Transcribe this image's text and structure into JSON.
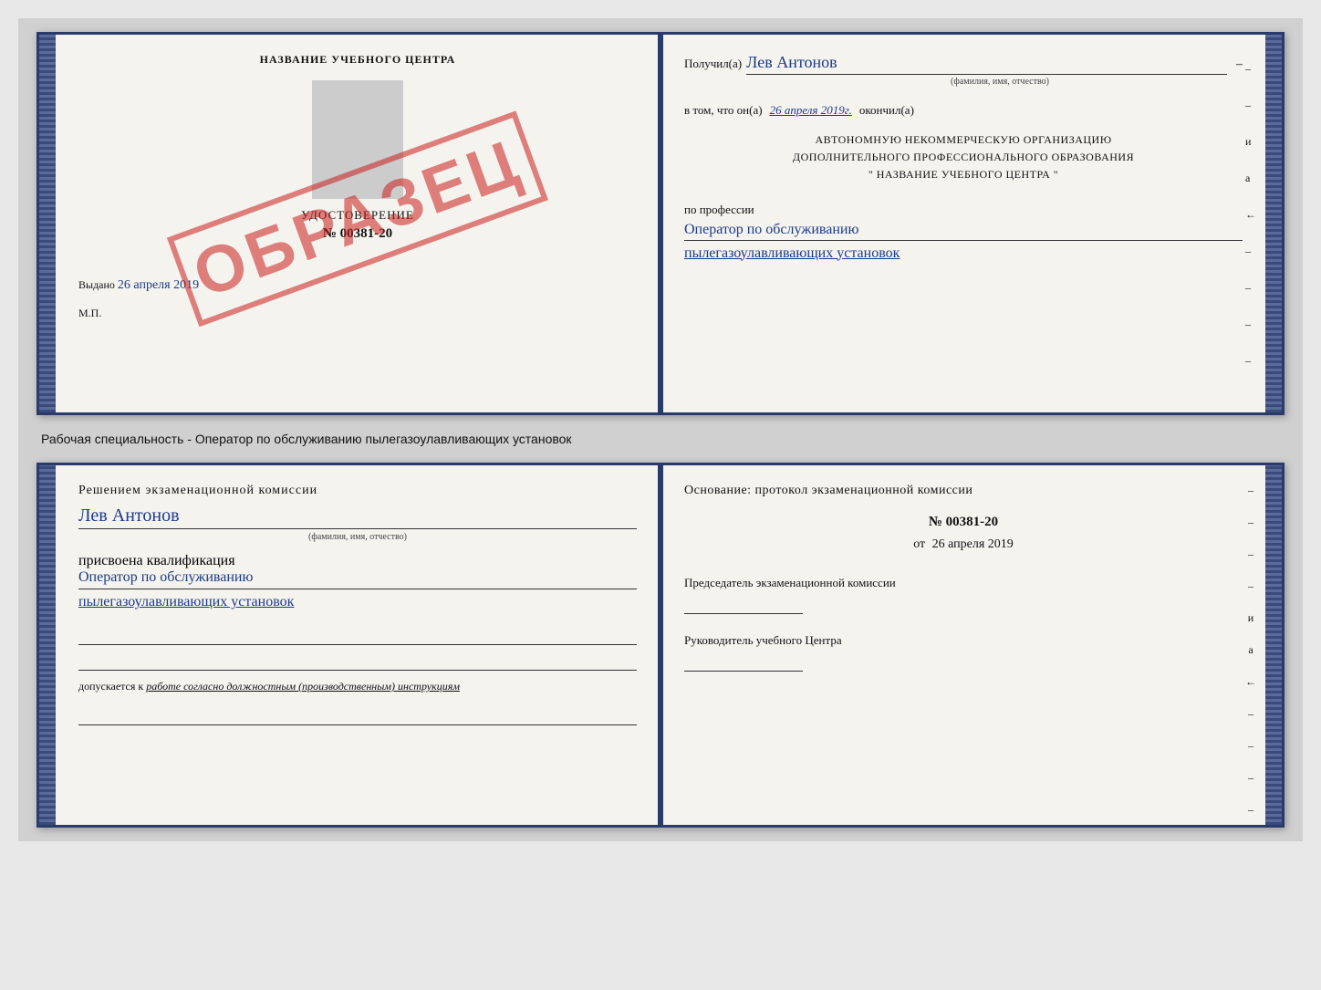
{
  "background": "#d0d0d0",
  "top_book": {
    "left_page": {
      "title": "НАЗВАНИЕ УЧЕБНОГО ЦЕНТРА",
      "udostoverenie_label": "УДОСТОВЕРЕНИЕ",
      "number": "№ 00381-20",
      "vydano_label": "Выдано",
      "vydano_date": "26 апреля 2019",
      "mp": "М.П.",
      "stamp_text": "ОБРАЗЕЦ"
    },
    "right_page": {
      "poluchil_label": "Получил(а)",
      "fio": "Лев Антонов",
      "fio_subtitle": "(фамилия, имя, отчество)",
      "v_tom_label": "в том, что он(а)",
      "date": "26 апреля 2019г.",
      "okonchil_label": "окончил(а)",
      "org_line1": "АВТОНОМНУЮ НЕКОММЕРЧЕСКУЮ ОРГАНИЗАЦИЮ",
      "org_line2": "ДОПОЛНИТЕЛЬНОГО ПРОФЕССИОНАЛЬНОГО ОБРАЗОВАНИЯ",
      "org_line3": "\"  НАЗВАНИЕ УЧЕБНОГО ЦЕНТРА  \"",
      "po_professii": "по профессии",
      "profession1": "Оператор по обслуживанию",
      "profession2": "пылегазоулавливающих установок",
      "side_chars": [
        "–",
        "–",
        "и",
        "а",
        "←",
        "–",
        "–",
        "–",
        "–"
      ]
    }
  },
  "caption": "Рабочая специальность - Оператор по обслуживанию пылегазоулавливающих установок",
  "bottom_book": {
    "left_page": {
      "resheniem": "Решением экзаменационной комиссии",
      "fio": "Лев Антонов",
      "fio_subtitle": "(фамилия, имя, отчество)",
      "prisvoena": "присвоена квалификация",
      "qual1": "Оператор по обслуживанию",
      "qual2": "пылегазоулавливающих установок",
      "dopuskaetsya_label": "допускается к",
      "dopusk_value": "работе согласно должностным (производственным) инструкциям"
    },
    "right_page": {
      "osnovanie": "Основание: протокол экзаменационной комиссии",
      "number": "№  00381-20",
      "ot_label": "от",
      "ot_date": "26 апреля 2019",
      "predsedatel_label": "Председатель экзаменационной комиссии",
      "rukovoditel_label": "Руководитель учебного Центра",
      "side_chars": [
        "–",
        "–",
        "–",
        "–",
        "и",
        "а",
        "←",
        "–",
        "–",
        "–",
        "–"
      ]
    }
  }
}
